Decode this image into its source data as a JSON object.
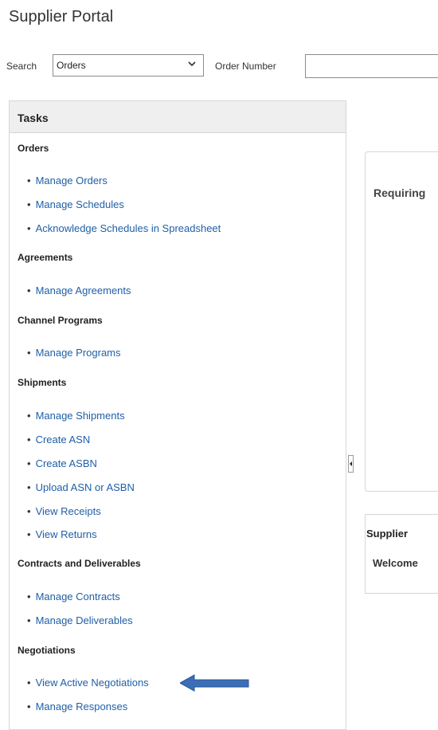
{
  "header": {
    "title": "Supplier Portal"
  },
  "search": {
    "label": "Search",
    "selected_option": "Orders",
    "order_number_label": "Order Number",
    "order_number_value": ""
  },
  "tasks": {
    "title": "Tasks",
    "sections": [
      {
        "title": "Orders",
        "links": [
          "Manage Orders",
          "Manage Schedules",
          "Acknowledge Schedules in Spreadsheet"
        ]
      },
      {
        "title": "Agreements",
        "links": [
          "Manage Agreements"
        ]
      },
      {
        "title": "Channel Programs",
        "links": [
          "Manage Programs"
        ]
      },
      {
        "title": "Shipments",
        "links": [
          "Manage Shipments",
          "Create ASN",
          "Create ASBN",
          "Upload ASN or ASBN",
          "View Receipts",
          "View Returns"
        ]
      },
      {
        "title": "Contracts and Deliverables",
        "links": [
          "Manage Contracts",
          "Manage Deliverables"
        ]
      },
      {
        "title": "Negotiations",
        "links": [
          "View Active Negotiations",
          "Manage Responses"
        ]
      }
    ]
  },
  "right": {
    "requiring_title": "Requiring",
    "supplier_title": "Supplier",
    "welcome_text": "Welcome"
  },
  "colors": {
    "link": "#1f5fa8",
    "arrow": "#3a6fb7"
  }
}
